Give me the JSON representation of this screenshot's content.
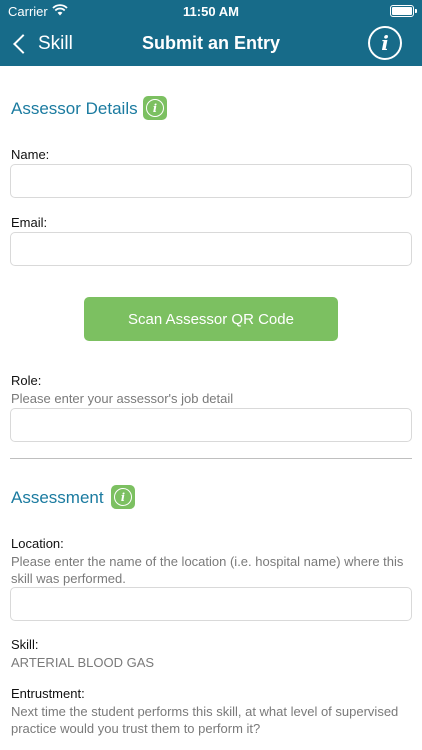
{
  "status_bar": {
    "carrier": "Carrier",
    "time": "11:50 AM"
  },
  "nav": {
    "back_label": "Skill",
    "title": "Submit an Entry"
  },
  "assessor_section": {
    "title": "Assessor Details",
    "name_label": "Name:",
    "name_value": "",
    "email_label": "Email:",
    "email_value": "",
    "scan_button": "Scan Assessor QR Code",
    "role_label": "Role:",
    "role_help": "Please enter your assessor's job detail",
    "role_value": ""
  },
  "assessment_section": {
    "title": "Assessment",
    "location_label": "Location:",
    "location_help": "Please enter the name of the location (i.e. hospital name) where this skill was performed.",
    "location_value": "",
    "skill_label": "Skill:",
    "skill_value": "ARTERIAL BLOOD GAS",
    "entrustment_label": "Entrustment:",
    "entrustment_help": "Next time the student performs this skill, at what level of supervised practice would you trust them to perform it?"
  },
  "colors": {
    "nav_bg": "#176b89",
    "accent_green": "#7cc061",
    "section_title": "#1b7ba0"
  }
}
